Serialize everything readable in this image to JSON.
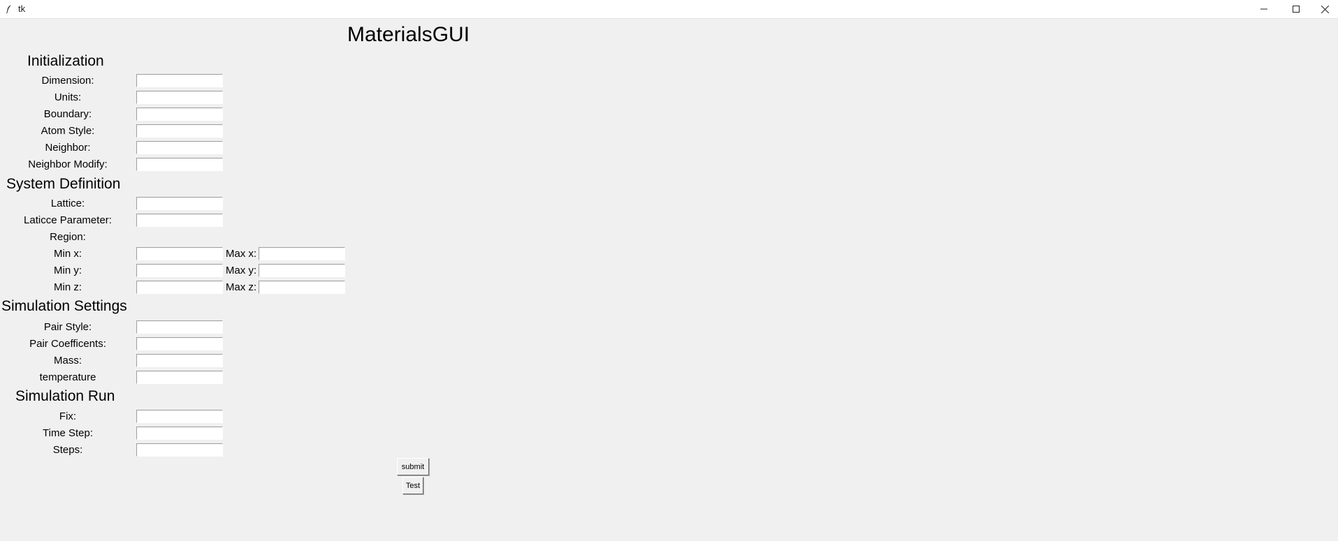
{
  "window": {
    "title": "tk",
    "icon": "feather-icon"
  },
  "app": {
    "title": "MaterialsGUI"
  },
  "initialization": {
    "heading": "Initialization",
    "fields": [
      {
        "label": "Dimension:",
        "value": ""
      },
      {
        "label": "Units:",
        "value": ""
      },
      {
        "label": "Boundary:",
        "value": ""
      },
      {
        "label": "Atom Style:",
        "value": ""
      },
      {
        "label": "Neighbor:",
        "value": ""
      },
      {
        "label": "Neighbor Modify:",
        "value": ""
      }
    ]
  },
  "system_definition": {
    "heading": "System Definition",
    "lattice": {
      "label": "Lattice:",
      "value": ""
    },
    "lattice_parameter": {
      "label": "Laticce Parameter:",
      "value": ""
    },
    "region": {
      "label": "Region:"
    },
    "min_x": {
      "label": "Min x:",
      "value": ""
    },
    "max_x": {
      "label": "Max x:",
      "value": ""
    },
    "min_y": {
      "label": "Min y:",
      "value": ""
    },
    "max_y": {
      "label": "Max y:",
      "value": ""
    },
    "min_z": {
      "label": "Min z:",
      "value": ""
    },
    "max_z": {
      "label": "Max z:",
      "value": ""
    }
  },
  "simulation_settings": {
    "heading": "Simulation Settings",
    "fields": [
      {
        "label": "Pair Style:",
        "value": ""
      },
      {
        "label": "Pair Coefficents:",
        "value": ""
      },
      {
        "label": "Mass:",
        "value": ""
      },
      {
        "label": "temperature",
        "value": ""
      }
    ]
  },
  "simulation_run": {
    "heading": "Simulation Run",
    "fields": [
      {
        "label": "Fix:",
        "value": ""
      },
      {
        "label": "Time Step:",
        "value": ""
      },
      {
        "label": "Steps:",
        "value": ""
      }
    ]
  },
  "buttons": {
    "submit": "submit",
    "test": "Test"
  }
}
